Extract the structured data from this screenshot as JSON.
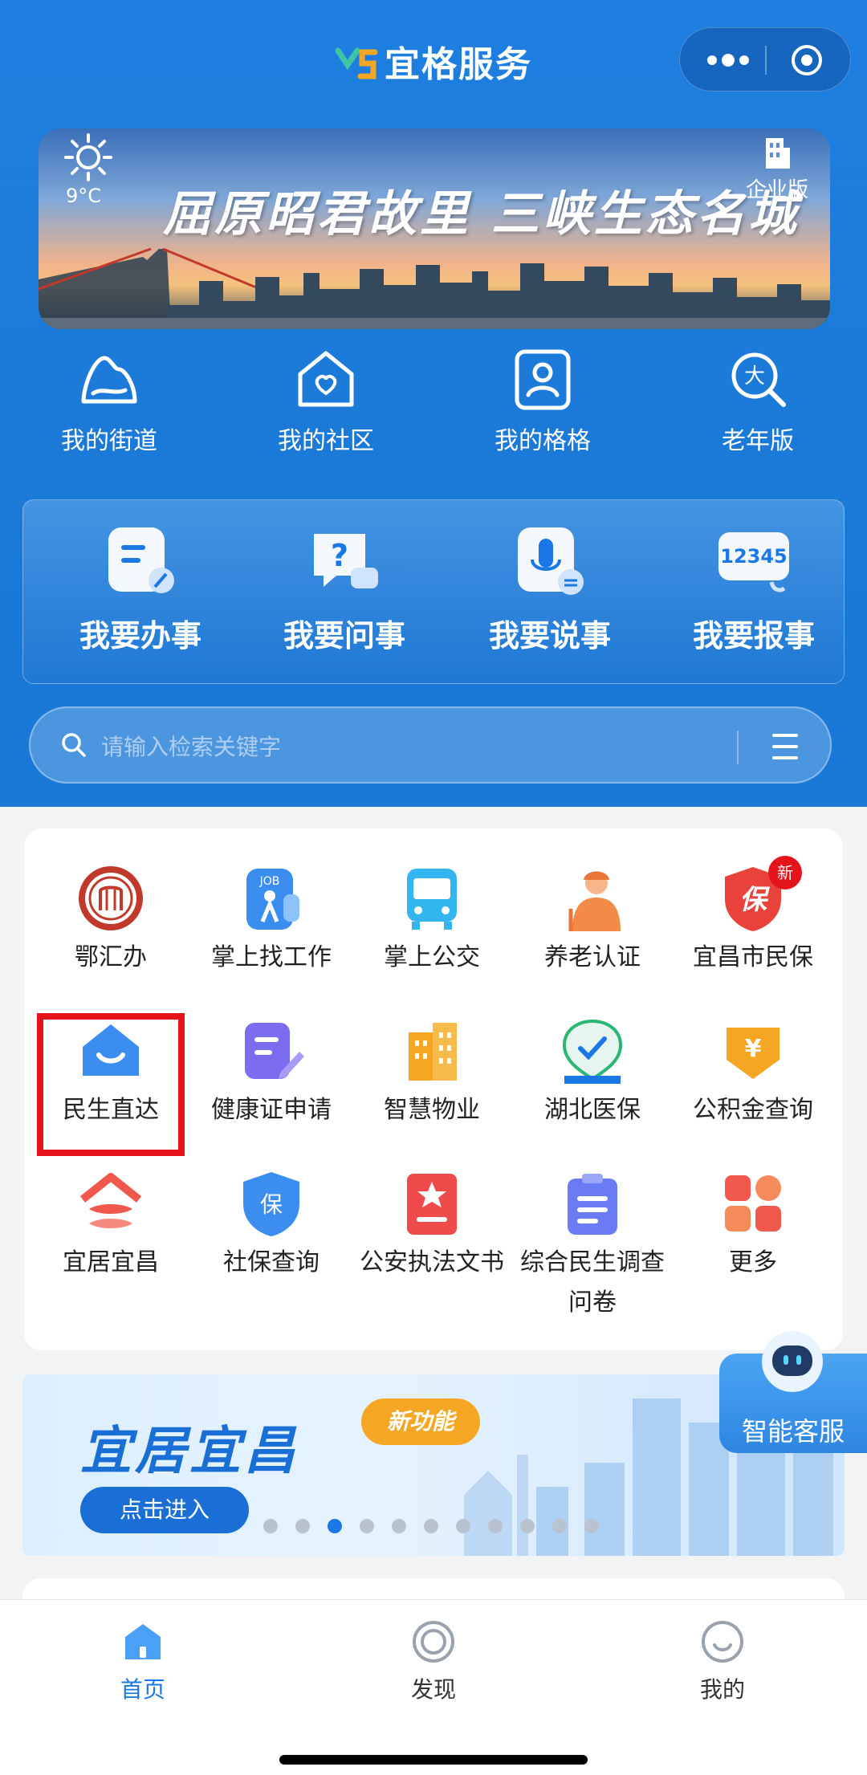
{
  "header": {
    "title": "宜格服务",
    "more_icon": "more-dots-icon",
    "close_icon": "target-circle-icon"
  },
  "banner": {
    "temperature": "9°C",
    "slogan": "屈原昭君故里  三峡生态名城",
    "enterprise_label": "企业版"
  },
  "quick_links": [
    {
      "label": "我的街道",
      "icon": "mountain-icon"
    },
    {
      "label": "我的社区",
      "icon": "house-heart-icon"
    },
    {
      "label": "我的格格",
      "icon": "person-card-icon"
    },
    {
      "label": "老年版",
      "icon": "magnifier-da-icon"
    }
  ],
  "actions": [
    {
      "label": "我要办事",
      "icon": "document-edit-icon"
    },
    {
      "label": "我要问事",
      "icon": "question-chat-icon"
    },
    {
      "label": "我要说事",
      "icon": "microphone-icon"
    },
    {
      "label": "我要报事",
      "icon": "hotline-12345-icon"
    }
  ],
  "hotline_number": "12345",
  "search": {
    "placeholder": "请输入检索关键字"
  },
  "services": [
    {
      "label": "鄂汇办",
      "icon": "ehuiban-logo-icon"
    },
    {
      "label": "掌上找工作",
      "icon": "job-search-icon"
    },
    {
      "label": "掌上公交",
      "icon": "bus-icon"
    },
    {
      "label": "养老认证",
      "icon": "elderly-person-icon"
    },
    {
      "label": "宜昌市民保",
      "icon": "shield-bao-icon",
      "badge": "新"
    },
    {
      "label": "民生直达",
      "icon": "home-smile-icon"
    },
    {
      "label": "健康证申请",
      "icon": "doc-pen-icon"
    },
    {
      "label": "智慧物业",
      "icon": "building-icon"
    },
    {
      "label": "湖北医保",
      "icon": "hubei-medical-icon"
    },
    {
      "label": "公积金查询",
      "icon": "yuan-box-icon"
    },
    {
      "label": "宜居宜昌",
      "icon": "house-stack-icon"
    },
    {
      "label": "社保查询",
      "icon": "shield-insurance-icon"
    },
    {
      "label": "公安执法文书",
      "icon": "police-document-icon"
    },
    {
      "label": "综合民生调查问卷",
      "icon": "clipboard-icon"
    },
    {
      "label": "更多",
      "icon": "grid-more-icon"
    }
  ],
  "service_icon_text": {
    "bao": "保",
    "yuan": "¥",
    "job": "JOB"
  },
  "promo": {
    "title": "宜居宜昌",
    "new_tag": "新功能",
    "button": "点击进入",
    "carousel_count": 11,
    "carousel_active": 2
  },
  "assistant": {
    "label": "智能客服"
  },
  "tabbar": [
    {
      "label": "首页",
      "icon": "home-icon",
      "active": true
    },
    {
      "label": "发现",
      "icon": "discover-ring-icon",
      "active": false
    },
    {
      "label": "我的",
      "icon": "profile-smile-icon",
      "active": false
    }
  ],
  "colors": {
    "brand_blue": "#1a78e6",
    "highlight_red": "#e5141b",
    "new_badge_orange": "#f5a623"
  }
}
